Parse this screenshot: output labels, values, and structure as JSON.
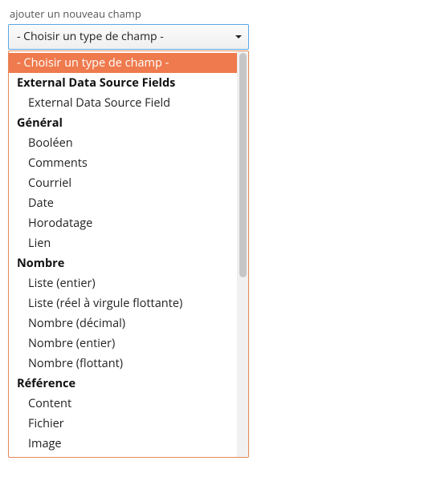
{
  "label": "ajouter un nouveau champ",
  "placeholderOption": "- Choisir un type de champ -",
  "groups": [
    {
      "label": "External Data Source Fields",
      "items": [
        "External Data Source Field"
      ]
    },
    {
      "label": "Général",
      "items": [
        "Booléen",
        "Comments",
        "Courriel",
        "Date",
        "Horodatage",
        "Lien"
      ]
    },
    {
      "label": "Nombre",
      "items": [
        "Liste (entier)",
        "Liste (réel à virgule flottante)",
        "Nombre (décimal)",
        "Nombre (entier)",
        "Nombre (flottant)"
      ]
    },
    {
      "label": "Référence",
      "items": [
        "Content",
        "Fichier",
        "Image"
      ]
    }
  ]
}
